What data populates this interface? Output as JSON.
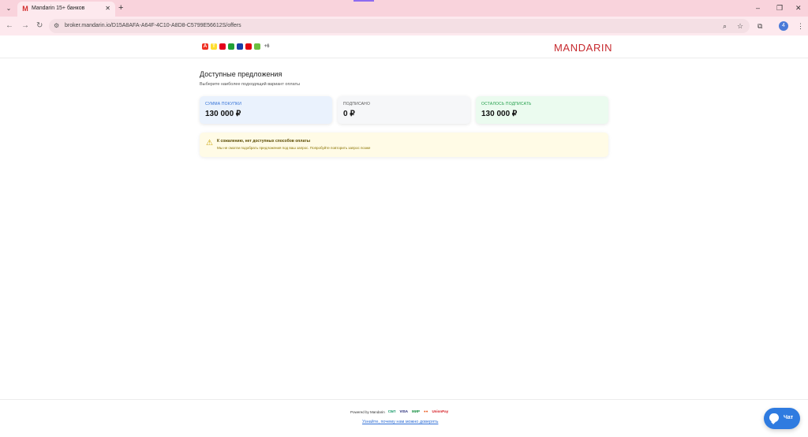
{
  "browser": {
    "tab_title": "Mandarin 15+ банков",
    "tab_favicon": "M",
    "tab_close": "✕",
    "new_tab": "+",
    "url": "broker.mandarin.io/D15A8AFA-A64F-4C10-A8D8-C5799E56612S/offers",
    "profile_initial": "4"
  },
  "header": {
    "brand": "MANDARIN",
    "bank_icons": [
      {
        "label": "А",
        "color": "#ef3124"
      },
      {
        "label": "Т",
        "color": "#ffdd2d"
      },
      {
        "label": "",
        "color": "#e3001b"
      },
      {
        "label": "",
        "color": "#21a038"
      },
      {
        "label": "",
        "color": "#1a3fa8"
      },
      {
        "label": "",
        "color": "#e30611"
      },
      {
        "label": "",
        "color": "#6cbf3f"
      },
      {
        "label": "+6",
        "color": "#9e9e9e"
      }
    ]
  },
  "main": {
    "title": "Доступные предложения",
    "subtitle": "Выберите наиболее подходящий вариант оплаты",
    "cards": [
      {
        "label": "СУММА ПОКУПКИ",
        "value": "130 000 ₽"
      },
      {
        "label": "ПОДПИСАНО",
        "value": "0 ₽"
      },
      {
        "label": "ОСТАЛОСЬ ПОДПИСАТЬ",
        "value": "130 000 ₽"
      }
    ],
    "alert": {
      "icon": "⚠",
      "title": "К сожалению, нет доступных способов оплаты",
      "text": "Мы не смогли подобрать предложения под ваш запрос. Попробуйте повторить запрос позже"
    }
  },
  "footer": {
    "powered_by": "Powered by Mandarin",
    "payment_logos": [
      "СБП",
      "VISA",
      "МИР",
      "●●",
      "UnionPay"
    ],
    "more_link": "Узнайте, почему нам можно доверять"
  },
  "chat": {
    "label": "Чат"
  }
}
